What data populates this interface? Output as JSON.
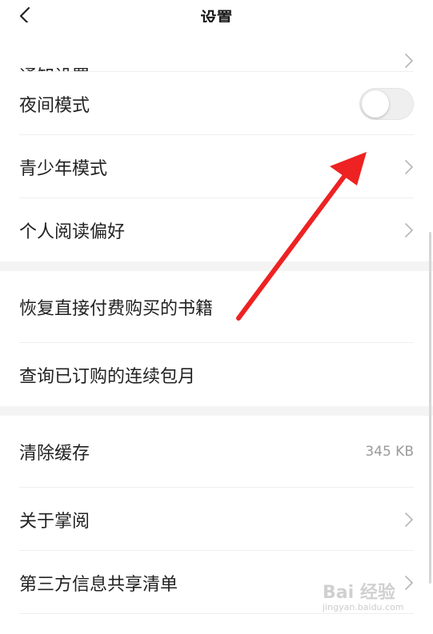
{
  "header": {
    "title": "设置"
  },
  "settings": {
    "notification": {
      "label": "通知设置"
    },
    "night_mode": {
      "label": "夜间模式",
      "enabled": false
    },
    "teen_mode": {
      "label": "青少年模式"
    },
    "reading_prefs": {
      "label": "个人阅读偏好"
    },
    "restore_purchases": {
      "label": "恢复直接付费购买的书籍"
    },
    "query_subscriptions": {
      "label": "查询已订购的连续包月"
    },
    "clear_cache": {
      "label": "清除缓存",
      "value": "345 KB"
    },
    "about": {
      "label": "关于掌阅"
    },
    "third_party_share": {
      "label": "第三方信息共享清单"
    }
  },
  "colors": {
    "background": "#ffffff",
    "section_gap": "#f4f4f4",
    "annotation_arrow": "#ee2222"
  },
  "watermark": {
    "logo": "Bai 经验",
    "sub": "jingyan.baidu.com"
  }
}
